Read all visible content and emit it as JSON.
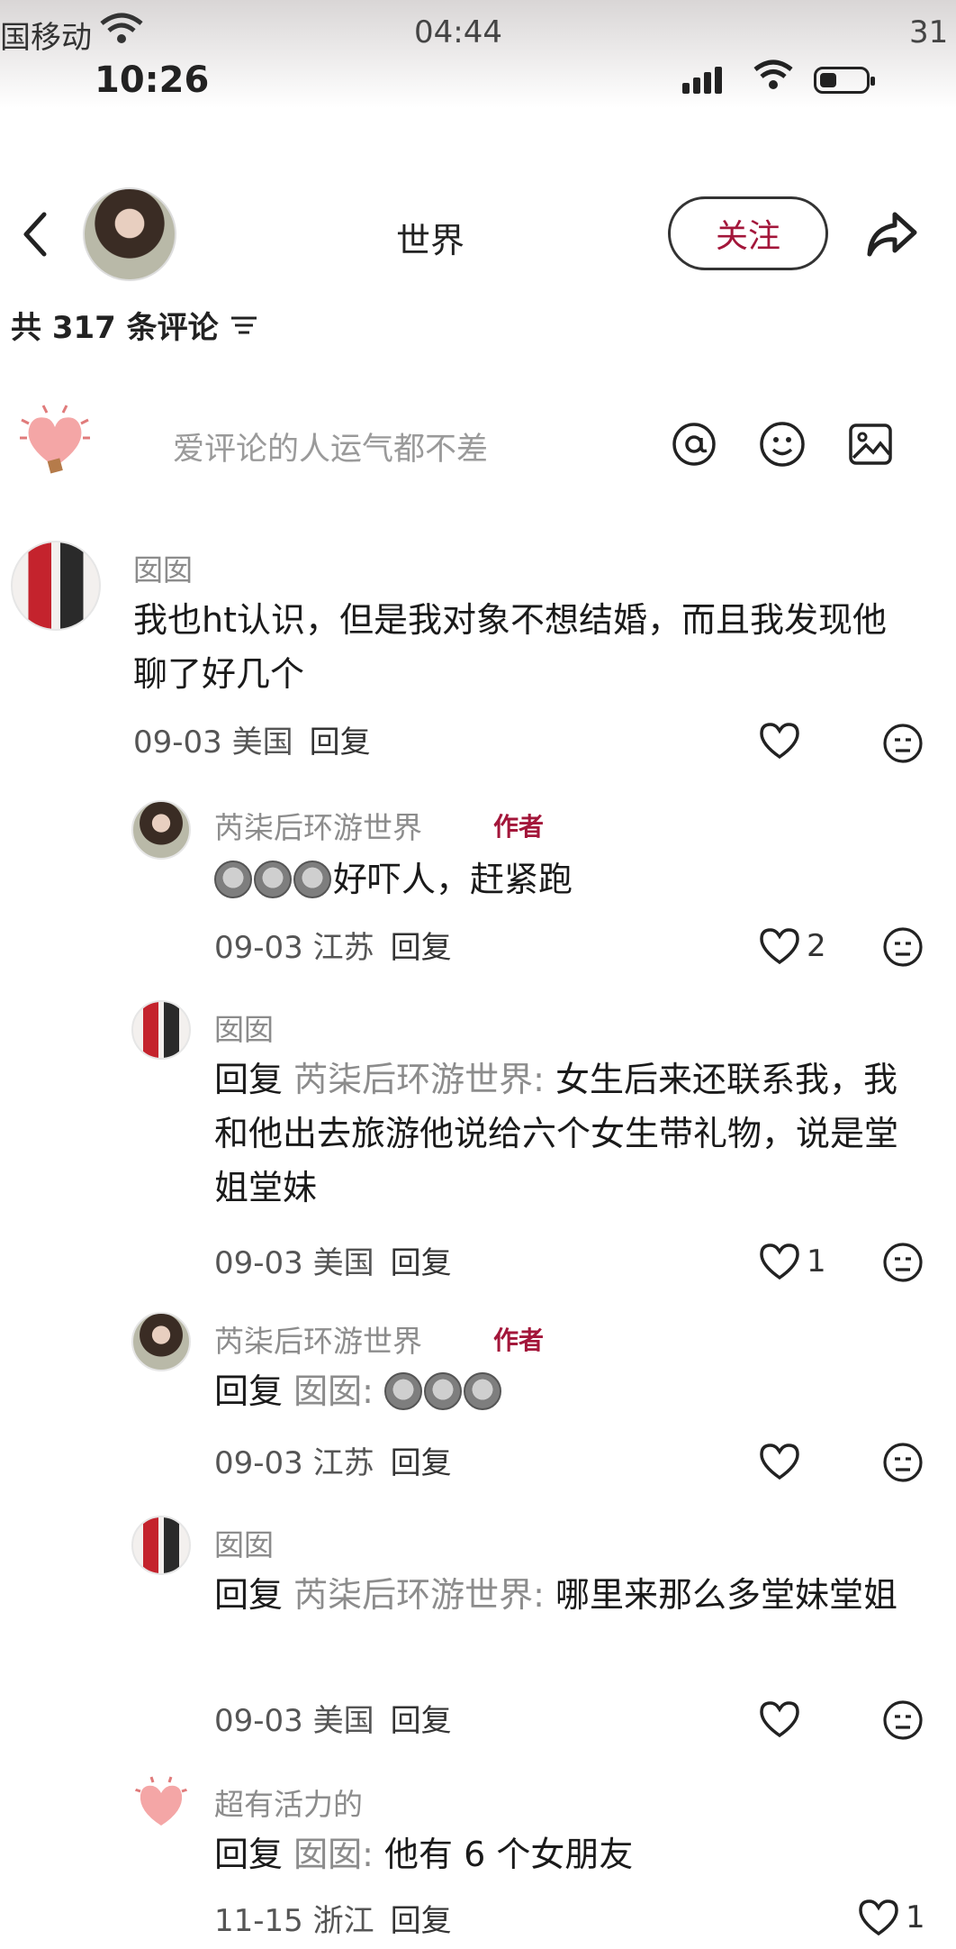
{
  "status_top": {
    "carrier": "国移动",
    "time": "04:44",
    "battery": "31"
  },
  "status": {
    "time": "10:26"
  },
  "header": {
    "name": "世界",
    "follow_label": "关注"
  },
  "comment_count": "共 317 条评论",
  "input": {
    "placeholder": "爱评论的人运气都不差"
  },
  "comments": [
    {
      "user": "囡囡",
      "text": "我也ht认识，但是我对象不想结婚，而且我发现他聊了好几个",
      "date": "09-03 美国",
      "reply_label": "回复"
    },
    {
      "user": "芮柒后环游世界",
      "tag": "作者",
      "text": "好吓人，赶紧跑",
      "date": "09-03 江苏",
      "reply_label": "回复",
      "likes": "2"
    },
    {
      "user": "囡囡",
      "reply_prefix": "回复",
      "target": "芮柒后环游世界:",
      "text": "女生后来还联系我，我和他出去旅游他说给六个女生带礼物，说是堂姐堂妹",
      "date": "09-03 美国",
      "reply_label": "回复",
      "likes": "1"
    },
    {
      "user": "芮柒后环游世界",
      "tag": "作者",
      "reply_prefix": "回复",
      "target": "囡囡:",
      "date": "09-03 江苏",
      "reply_label": "回复"
    },
    {
      "user": "囡囡",
      "reply_prefix": "回复",
      "target": "芮柒后环游世界:",
      "text": "哪里来那么多堂妹堂姐",
      "date": "09-03 美国",
      "reply_label": "回复"
    },
    {
      "user": "超有活力的",
      "reply_prefix": "回复",
      "target": "囡囡:",
      "text": "他有 6 个女朋友",
      "date": "11-15 浙江",
      "reply_label": "回复",
      "likes": "1"
    }
  ]
}
